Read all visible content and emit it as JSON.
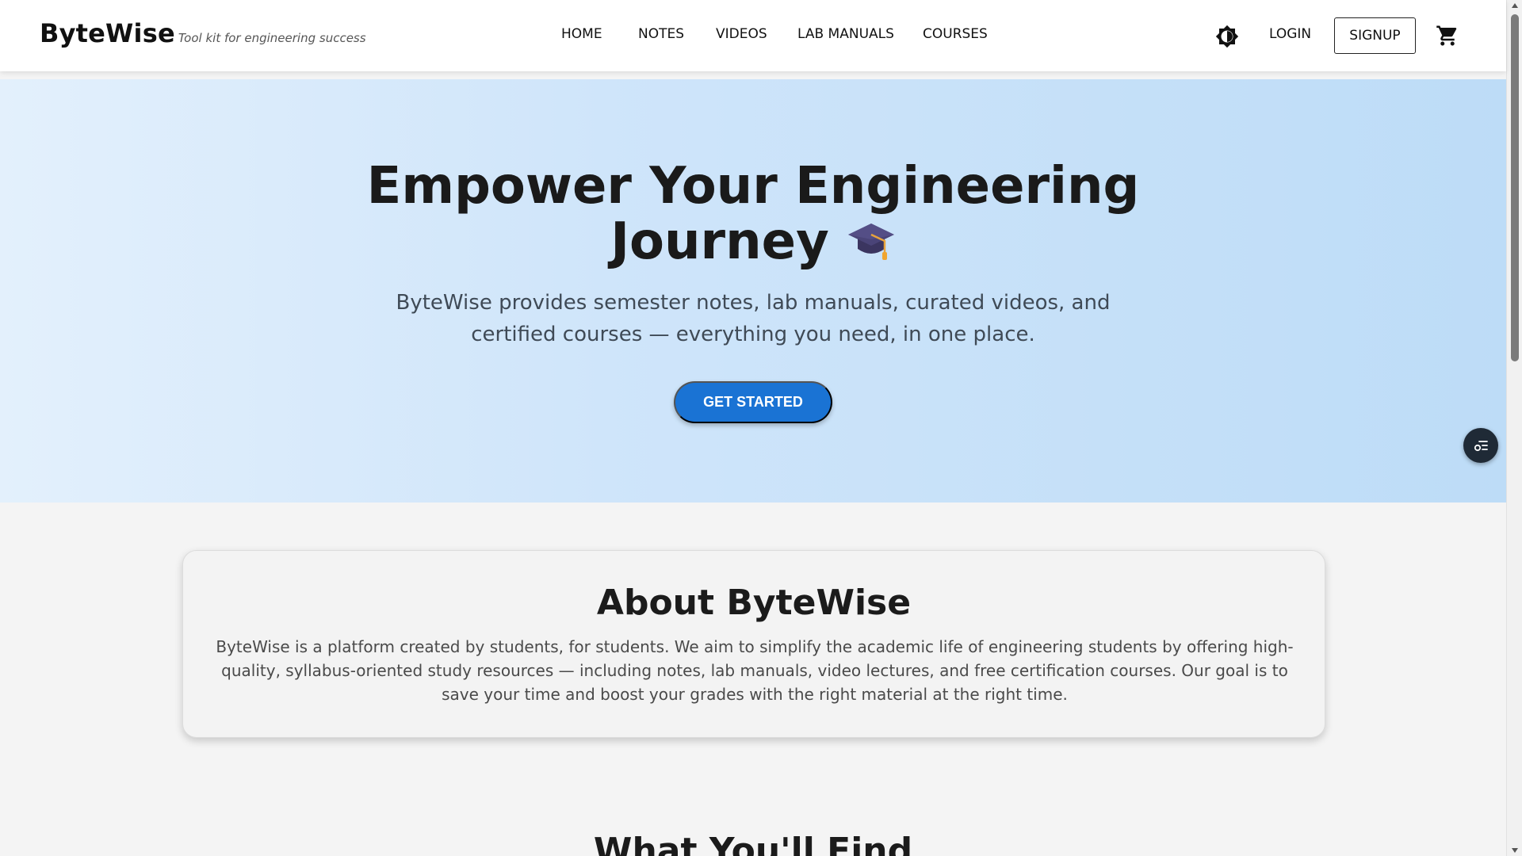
{
  "navbar": {
    "brand": "ByteWise",
    "tagline": "Tool kit for engineering success",
    "links": [
      "HOME",
      "NOTES",
      "VIDEOS",
      "LAB MANUALS",
      "COURSES"
    ],
    "theme_toggle_icon": "brightness-icon",
    "login_label": "LOGIN",
    "signup_label": "SIGNUP",
    "cart_icon": "cart-icon"
  },
  "hero": {
    "title_line1": "Empower Your Engineering",
    "title_line2": "Journey",
    "title_icon": "graduation-cap-icon",
    "subtitle": "ByteWise provides semester notes, lab manuals, curated videos, and certified courses — everything you need, in one place.",
    "cta_label": "GET STARTED",
    "floating_icon": "list-settings-icon"
  },
  "about": {
    "title": "About ByteWise",
    "text": "ByteWise is a platform created by students, for students. We aim to simplify the academic life of engineering students by offering high-quality, syllabus-oriented study resources — including notes, lab manuals, video lectures, and free certification courses. Our goal is to save your time and boost your grades with the right material at the right time."
  },
  "find": {
    "title": "What You'll Find"
  },
  "colors": {
    "accent": "#1a73d4",
    "hero_gradient_start": "#e3f0fc",
    "hero_gradient_end": "#bddcf7",
    "page_bg": "#f4f4f4"
  }
}
